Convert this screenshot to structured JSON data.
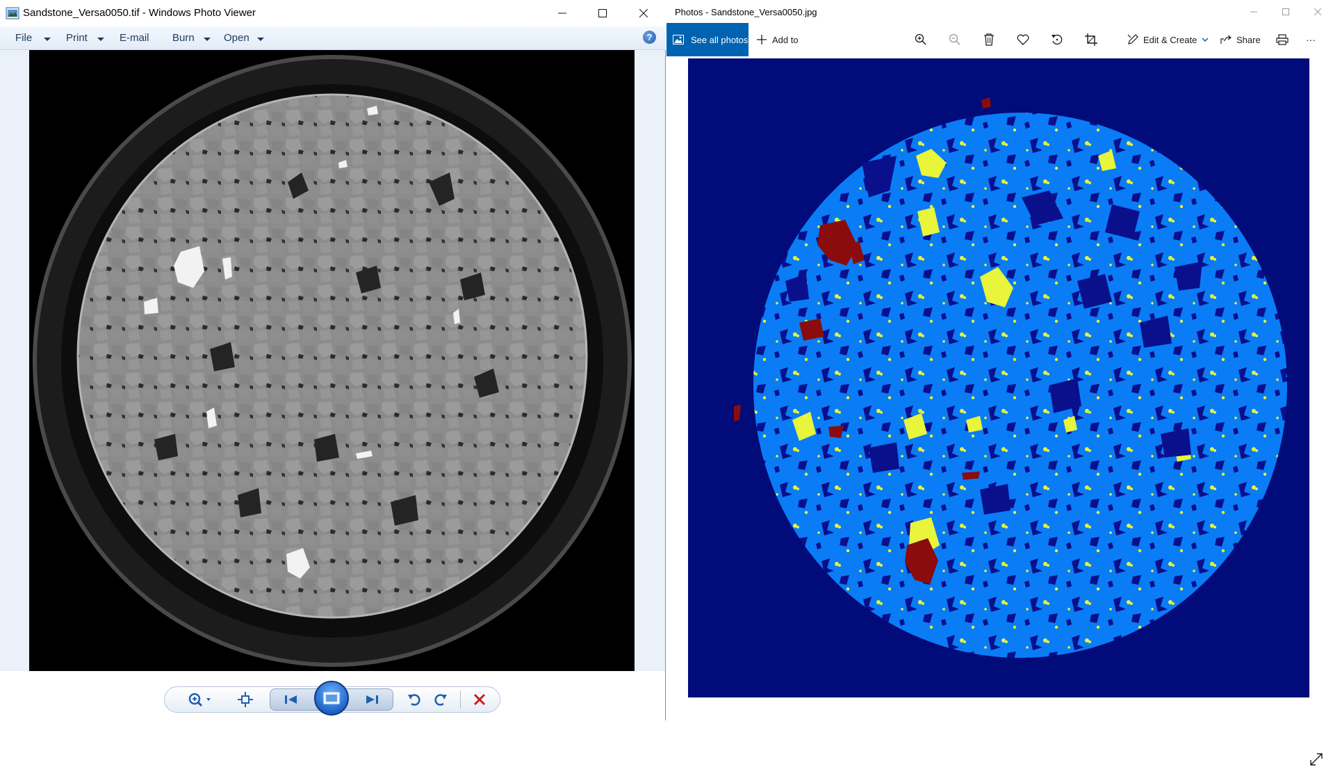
{
  "photo_viewer": {
    "title": "Sandstone_Versa0050.tif - Windows Photo Viewer",
    "menu": {
      "file": "File",
      "print": "Print",
      "email": "E-mail",
      "burn": "Burn",
      "open": "Open"
    },
    "help_symbol": "?",
    "image": {
      "description_kind": "grayscale micro-CT slice",
      "background_color": "#000000"
    },
    "controls": [
      "zoom",
      "fit-to-window",
      "previous",
      "play-slideshow",
      "next",
      "rotate-counterclockwise",
      "rotate-clockwise",
      "delete"
    ]
  },
  "photos_app": {
    "title": "Photos - Sandstone_Versa0050.jpg",
    "toolbar": {
      "see_all_photos": "See all photos",
      "add_to": "Add to",
      "edit_create": "Edit & Create",
      "share": "Share",
      "more": "···"
    },
    "colors": {
      "accent": "#0063b1",
      "background_phase": "#010b7a",
      "grain_phase": "#0a7cf5",
      "pore_phase": "#0a0f8c",
      "mineral_phase": "#e8f53a",
      "dense_phase": "#8a0c0c"
    }
  }
}
